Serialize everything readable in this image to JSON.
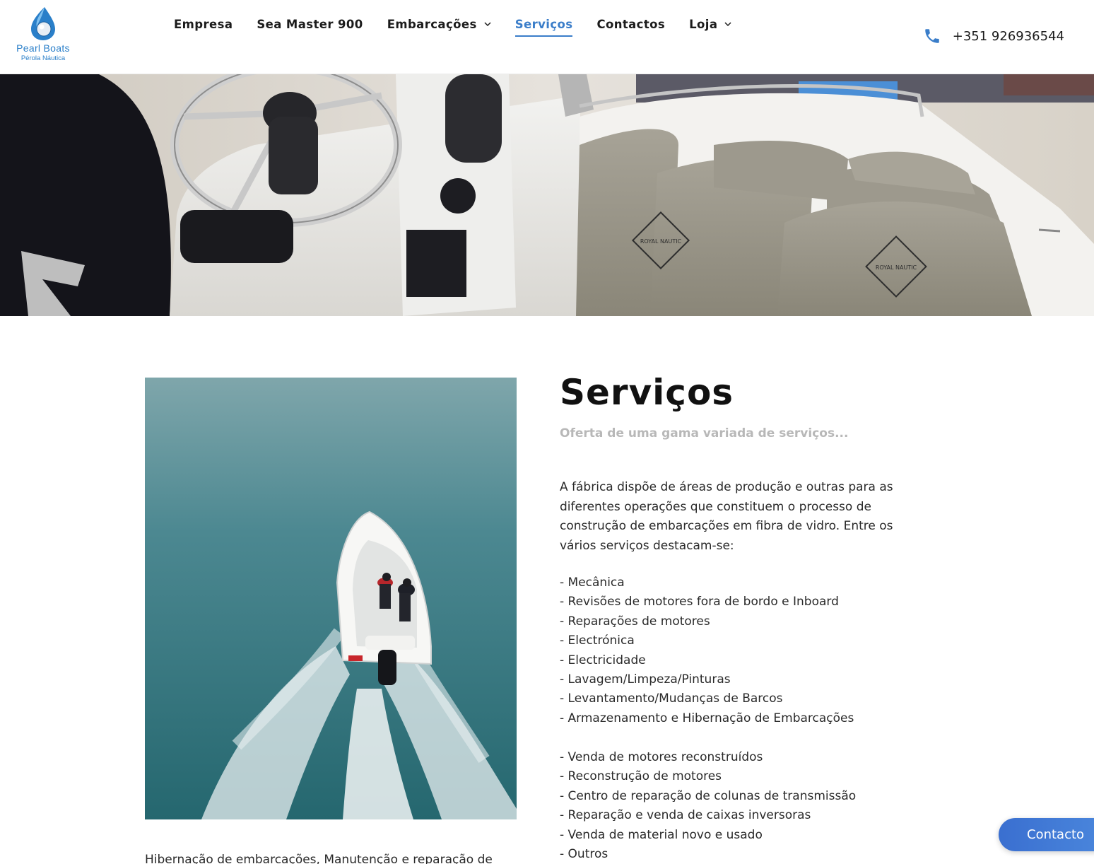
{
  "brand": {
    "name": "Pearl Boats",
    "tagline": "Pérola Náutica",
    "primary_color": "#3a7dc9"
  },
  "nav": {
    "items": [
      {
        "label": "Empresa",
        "dropdown": false,
        "active": false
      },
      {
        "label": "Sea Master 900",
        "dropdown": false,
        "active": false
      },
      {
        "label": "Embarcações",
        "dropdown": true,
        "active": false
      },
      {
        "label": "Serviços",
        "dropdown": false,
        "active": true
      },
      {
        "label": "Contactos",
        "dropdown": false,
        "active": false
      },
      {
        "label": "Loja",
        "dropdown": true,
        "active": false
      }
    ]
  },
  "phone": {
    "icon": "phone-icon",
    "number": "+351 926936544"
  },
  "hero": {
    "image": "boat-cockpit-steering-wheel-seats",
    "seat_logo_text": "ROYAL NAUTIC"
  },
  "content": {
    "image": "aerial-boat-on-sea",
    "title": "Serviços",
    "subtitle": "Oferta de uma gama variada de serviços...",
    "intro": "A fábrica dispõe de áreas de produção e outras para as diferentes operações que constituem o processo de construção de embarcações em fibra de vidro. Entre os vários serviços destacam-se:",
    "services_group1": [
      "- Mecânica",
      "- Revisões de motores fora de bordo e Inboard",
      "- Reparações de motores",
      "- Electrónica",
      "- Electricidade",
      "- Lavagem/Limpeza/Pinturas",
      "- Levantamento/Mudanças de Barcos",
      "- Armazenamento e Hibernação de Embarcações"
    ],
    "services_group2": [
      "- Venda de motores reconstruídos",
      "- Reconstrução de motores",
      "- Centro de reparação de colunas de transmissão",
      "- Reparação e venda de caixas inversoras",
      "- Venda de material novo e usado",
      "- Outros"
    ],
    "bottom_text": "Hibernação de embarcações, Manutenção e reparação de"
  },
  "contact_button": {
    "label": "Contacto"
  }
}
